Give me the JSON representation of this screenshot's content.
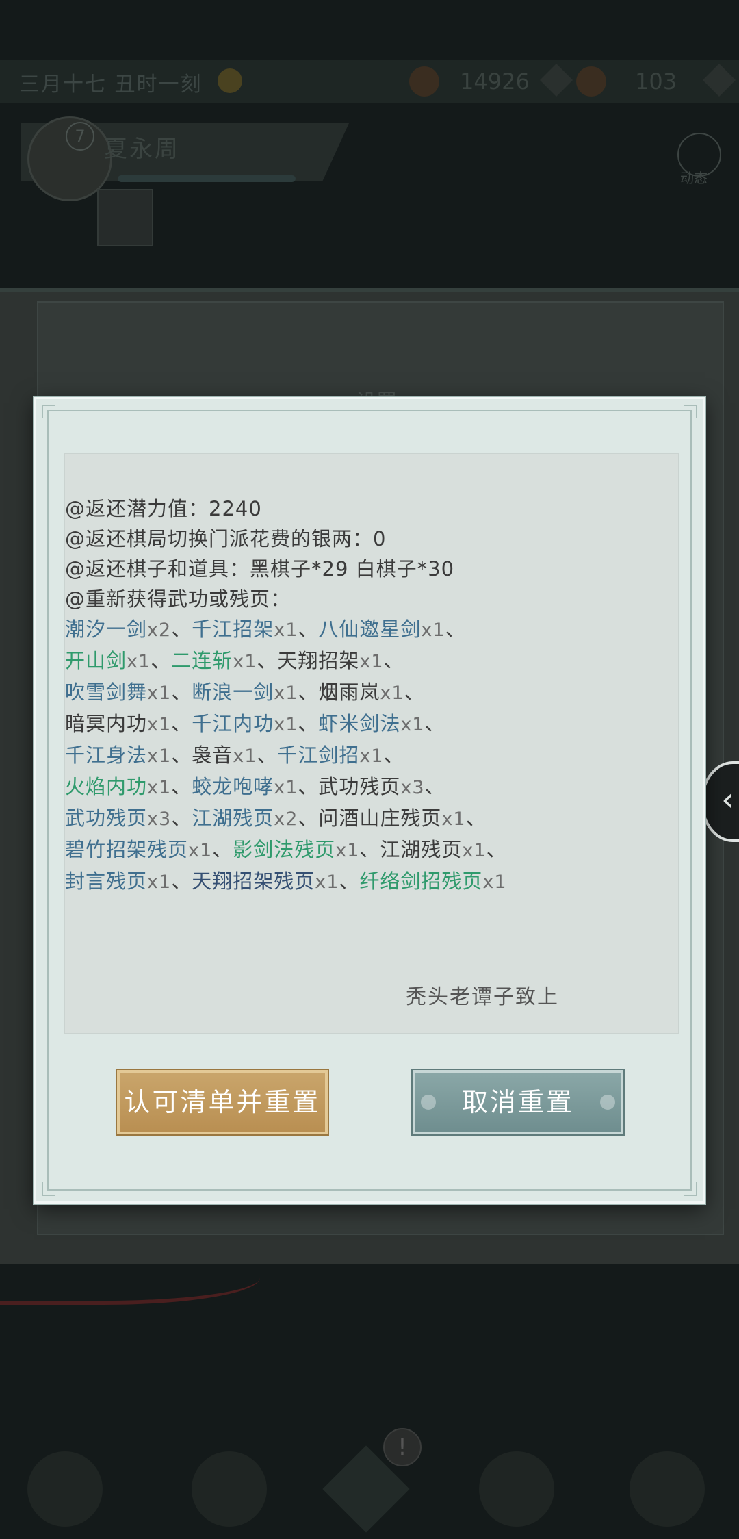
{
  "background": {
    "date_text": "三月十七 丑时一刻",
    "currency1_value": "14926",
    "currency2_value": "103",
    "character_level": "7",
    "character_name": "夏永周",
    "dynamics_label": "动态",
    "panel_title": "设置"
  },
  "dialog": {
    "lines_intro": [
      {
        "label": "@返还潜力值：",
        "value": "2240"
      },
      {
        "label": "@返还棋局切换门派花费的银两：",
        "value": "0"
      },
      {
        "label": "@返还棋子和道具：",
        "value": "黑棋子*29 白棋子*30"
      },
      {
        "label": "@重新获得武功或残页：",
        "value": ""
      }
    ],
    "item_rows": [
      [
        {
          "name": "潮汐一剑",
          "qty": "x2",
          "color": "blue"
        },
        {
          "name": "千江招架",
          "qty": "x1",
          "color": "blue"
        },
        {
          "name": "八仙邀星剑",
          "qty": "x1",
          "color": "blue"
        }
      ],
      [
        {
          "name": "开山剑",
          "qty": "x1",
          "color": "green"
        },
        {
          "name": "二连斩",
          "qty": "x1",
          "color": "green"
        },
        {
          "name": "天翔招架",
          "qty": "x1",
          "color": "plain"
        }
      ],
      [
        {
          "name": "吹雪剑舞",
          "qty": "x1",
          "color": "blue"
        },
        {
          "name": "断浪一剑",
          "qty": "x1",
          "color": "blue"
        },
        {
          "name": "烟雨岚",
          "qty": "x1",
          "color": "plain"
        }
      ],
      [
        {
          "name": "暗冥内功",
          "qty": "x1",
          "color": "plain"
        },
        {
          "name": "千江内功",
          "qty": "x1",
          "color": "blue"
        },
        {
          "name": "虾米剑法",
          "qty": "x1",
          "color": "blue"
        }
      ],
      [
        {
          "name": "千江身法",
          "qty": "x1",
          "color": "blue"
        },
        {
          "name": "袅音",
          "qty": "x1",
          "color": "plain"
        },
        {
          "name": "千江剑招",
          "qty": "x1",
          "color": "blue"
        }
      ],
      [
        {
          "name": "火焰内功",
          "qty": "x1",
          "color": "green"
        },
        {
          "name": "蛟龙咆哮",
          "qty": "x1",
          "color": "blue"
        },
        {
          "name": "武功残页",
          "qty": "x3",
          "color": "plain"
        }
      ],
      [
        {
          "name": "武功残页",
          "qty": "x3",
          "color": "blue"
        },
        {
          "name": "江湖残页",
          "qty": "x2",
          "color": "blue"
        },
        {
          "name": "问酒山庄残页",
          "qty": "x1",
          "color": "plain"
        }
      ],
      [
        {
          "name": "碧竹招架残页",
          "qty": "x1",
          "color": "blue"
        },
        {
          "name": "影剑法残页",
          "qty": "x1",
          "color": "green"
        },
        {
          "name": "江湖残页",
          "qty": "x1",
          "color": "plain"
        }
      ],
      [
        {
          "name": "封言残页",
          "qty": "x1",
          "color": "blue"
        },
        {
          "name": "天翔招架残页",
          "qty": "x1",
          "color": "navy"
        },
        {
          "name": "纤络剑招残页",
          "qty": "x1",
          "color": "green"
        }
      ]
    ],
    "row_endings": [
      "、",
      "、",
      "、",
      "、",
      "、",
      "、",
      "、",
      "、",
      ""
    ],
    "separator": "、",
    "signature": "秃头老谭子致上",
    "confirm_label": "认可清单并重置",
    "cancel_label": "取消重置"
  }
}
